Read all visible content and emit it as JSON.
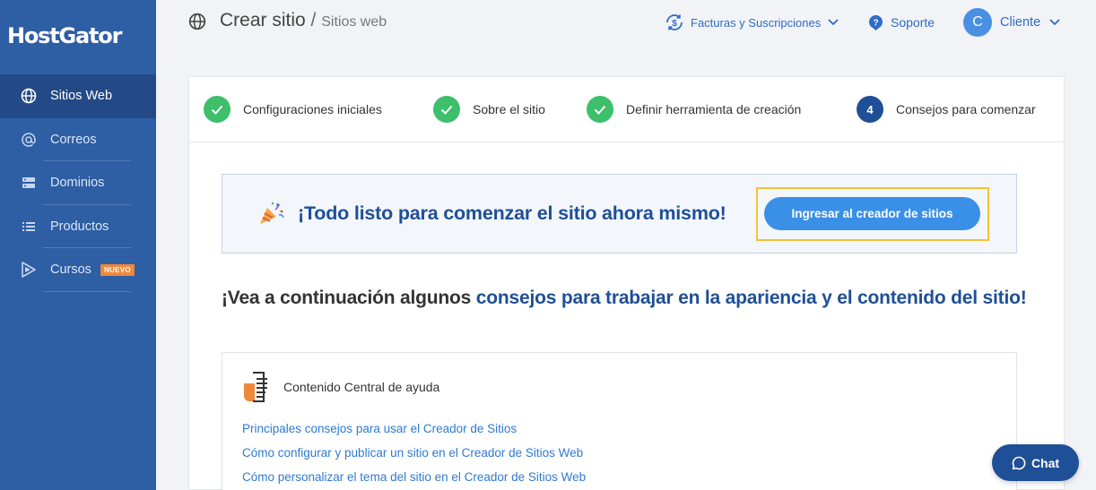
{
  "brand": {
    "logo_text": "HostGator"
  },
  "sidebar": {
    "items": [
      {
        "label": "Sitios Web",
        "icon": "globe-icon",
        "active": true
      },
      {
        "label": "Correos",
        "icon": "at-icon",
        "active": false
      },
      {
        "label": "Dominios",
        "icon": "server-icon",
        "active": false
      },
      {
        "label": "Productos",
        "icon": "list-icon",
        "active": false
      },
      {
        "label": "Cursos",
        "icon": "play-icon",
        "active": false,
        "badge": "NUEVO"
      }
    ]
  },
  "header": {
    "title": "Crear sitio",
    "separator": "/",
    "breadcrumb": "Sitios web",
    "billing_label": "Facturas y Suscripciones",
    "support_label": "Soporte",
    "client_initial": "C",
    "client_label": "Cliente"
  },
  "steps": [
    {
      "label": "Configuraciones iniciales",
      "status": "done"
    },
    {
      "label": "Sobre el sitio",
      "status": "done"
    },
    {
      "label": "Definir herramienta de creación",
      "status": "done"
    },
    {
      "label": "Consejos para comenzar",
      "status": "current",
      "number": "4"
    }
  ],
  "banner": {
    "text": "¡Todo listo para comenzar el sitio ahora mismo!",
    "cta_label": "Ingresar al creador de sitios"
  },
  "tips": {
    "heading_dark": "¡Vea a continuación algunos ",
    "heading_blue": "consejos para trabajar en la apariencia y el contenido del sitio!"
  },
  "help_card": {
    "title": "Contenido Central de ayuda",
    "links": [
      "Principales consejos para usar el Creador de Sitios",
      "Cómo configurar y publicar un sitio en el Creador de Sitios Web",
      "Cómo personalizar el tema del sitio en el Creador de Sitios Web"
    ]
  },
  "chat": {
    "label": "Chat"
  },
  "colors": {
    "sidebar": "#2e5ea4",
    "sidebar_active": "#234a86",
    "primary": "#1f4f96",
    "accent": "#3a8fe6",
    "success": "#3dbf6c",
    "highlight": "#f3c13a",
    "badge": "#f0883a"
  }
}
